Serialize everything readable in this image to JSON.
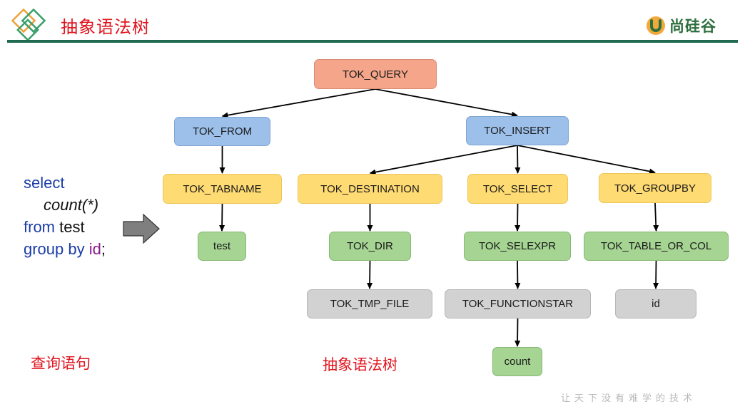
{
  "header": {
    "title": "抽象语法树",
    "brand_name": "尚硅谷"
  },
  "query": {
    "keyword_select": "select",
    "func_name": "count",
    "func_args": "(*)",
    "keyword_from": "from",
    "table": "test",
    "keyword_group_by": "group by",
    "group_col": "id",
    "terminator": ";"
  },
  "tree": {
    "nodes": [
      {
        "id": "tok_query",
        "label": "TOK_QUERY",
        "color": "red"
      },
      {
        "id": "tok_from",
        "label": "TOK_FROM",
        "color": "blue"
      },
      {
        "id": "tok_insert",
        "label": "TOK_INSERT",
        "color": "blue"
      },
      {
        "id": "tok_tabname",
        "label": "TOK_TABNAME",
        "color": "yellow"
      },
      {
        "id": "tok_destination",
        "label": "TOK_DESTINATION",
        "color": "yellow"
      },
      {
        "id": "tok_select",
        "label": "TOK_SELECT",
        "color": "yellow"
      },
      {
        "id": "tok_groupby",
        "label": "TOK_GROUPBY",
        "color": "yellow"
      },
      {
        "id": "test",
        "label": "test",
        "color": "green"
      },
      {
        "id": "tok_dir",
        "label": "TOK_DIR",
        "color": "green"
      },
      {
        "id": "tok_selexpr",
        "label": "TOK_SELEXPR",
        "color": "green"
      },
      {
        "id": "tok_table_or_col",
        "label": "TOK_TABLE_OR_COL",
        "color": "green"
      },
      {
        "id": "tok_tmp_file",
        "label": "TOK_TMP_FILE",
        "color": "gray"
      },
      {
        "id": "tok_functionstar",
        "label": "TOK_FUNCTIONSTAR",
        "color": "gray"
      },
      {
        "id": "id",
        "label": "id",
        "color": "gray"
      },
      {
        "id": "count",
        "label": "count",
        "color": "green"
      }
    ],
    "edges": [
      [
        "tok_query",
        "tok_from"
      ],
      [
        "tok_query",
        "tok_insert"
      ],
      [
        "tok_from",
        "tok_tabname"
      ],
      [
        "tok_insert",
        "tok_destination"
      ],
      [
        "tok_insert",
        "tok_select"
      ],
      [
        "tok_insert",
        "tok_groupby"
      ],
      [
        "tok_tabname",
        "test"
      ],
      [
        "tok_destination",
        "tok_dir"
      ],
      [
        "tok_select",
        "tok_selexpr"
      ],
      [
        "tok_groupby",
        "tok_table_or_col"
      ],
      [
        "tok_dir",
        "tok_tmp_file"
      ],
      [
        "tok_selexpr",
        "tok_functionstar"
      ],
      [
        "tok_table_or_col",
        "id"
      ],
      [
        "tok_functionstar",
        "count"
      ]
    ]
  },
  "captions": {
    "query_caption": "查询语句",
    "tree_caption": "抽象语法树"
  },
  "footer": {
    "watermark": "让天下没有难学的技术"
  },
  "colors": {
    "title_red": "#e0141e",
    "rule_green": "#1f6b52",
    "brand_green": "#2e6f3e",
    "keyword_blue": "#1b3da8",
    "identifier_purple": "#8a1a8a"
  }
}
